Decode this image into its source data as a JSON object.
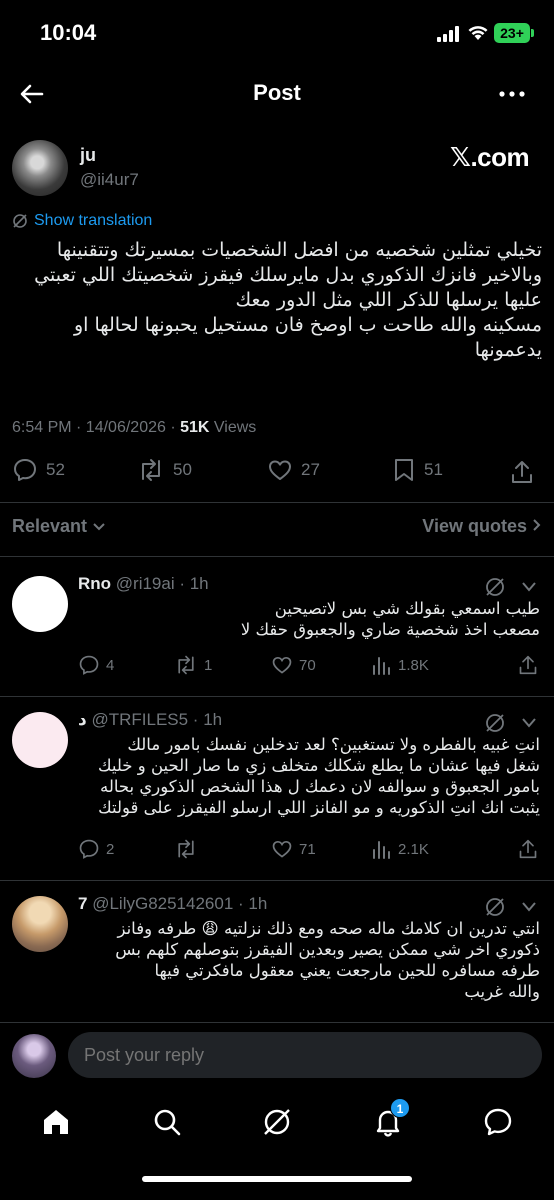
{
  "status_bar": {
    "time": "10:04",
    "battery": "23+"
  },
  "nav": {
    "title": "Post"
  },
  "post": {
    "author_name": "ju",
    "author_handle": "@ii4ur7",
    "source": "𝕏.com",
    "translate_label": "Show translation",
    "text_lines": [
      "تخيلي تمثلين شخصيه من افضل الشخصيات بمسيرتك وتتقنينها",
      "وبالاخير فانزك الذكوري بدل مايرسلك فيقرز شخصيتك اللي تعبتي",
      "عليها يرسلها للذكر اللي مثل الدور معك",
      "مسكينه والله طاحت ب اوصخ فان مستحيل يحبونها لحالها او",
      "يدعمونها"
    ],
    "timestamp": "6:54 PM · 14/06/2026 · ",
    "views_count": "51K",
    "views_label": " Views",
    "replies": "52",
    "reposts": "50",
    "likes": "27",
    "bookmarks": "51"
  },
  "sort": {
    "relevant": "Relevant",
    "view_quotes": "View quotes"
  },
  "replies": [
    {
      "name": "Rno",
      "handle": "@ri19ai · 1h",
      "text_lines": [
        "طيب اسمعي بقولك شي بس لاتصيحين",
        "مصعب اخذ شخصية ضاري والجعبوق حقك لا"
      ],
      "replies": "4",
      "reposts": "1",
      "likes": "70",
      "views": "1.8K",
      "avatar_color": "#ffffff"
    },
    {
      "name": "د",
      "handle": "@TRFILES5 · 1h",
      "text_lines": [
        "انتِ غبيه بالفطره ولا تستغبين؟ لعد تدخلين نفسك بامور مالك",
        "شغل فيها عشان ما يطلع شكلك متخلف زي ما صار الحين و خليك",
        "بامور الجعبوق و سوالفه لان دعمك ل هذا الشخص الذكوري بحاله",
        "يثبت انك انتِ الذكوريه و مو الفانز اللي ارسلو الفيقرز على قولتك"
      ],
      "replies": "2",
      "reposts": "",
      "likes": "71",
      "views": "2.1K",
      "avatar_color": "#fbeaf0"
    },
    {
      "name": "7",
      "handle": "@LilyG825142601 · 1h",
      "text_lines": [
        "انتي تدرين ان كلامك ماله صحه ومع ذلك نزلتيه 😩 طرفه وفانز",
        "ذكوري اخر شي ممكن يصير وبعدين الفيقرز بتوصلهم كلهم بس",
        "طرفه مسافره للحين مارجعت يعني معقول مافكرتي فيها",
        "والله غريب"
      ]
    }
  ],
  "composer": {
    "placeholder": "Post your reply"
  },
  "tabbar": {
    "notifications_badge": "1"
  },
  "colors": {
    "accent": "#1d9bf0",
    "muted": "#71767b",
    "background": "#000000"
  }
}
